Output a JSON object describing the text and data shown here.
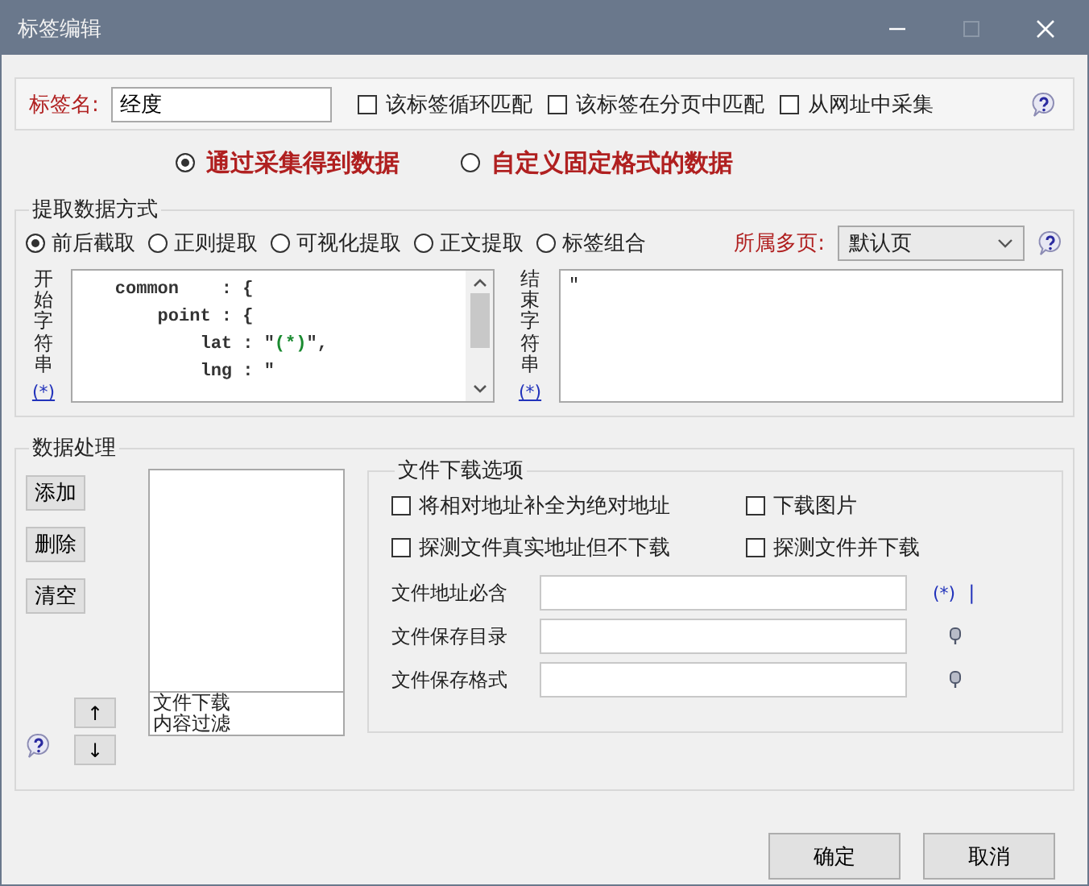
{
  "window": {
    "title": "标签编辑"
  },
  "tag_name": {
    "label": "标签名:",
    "value": "经度"
  },
  "tag_options": [
    {
      "label": "该标签循环匹配",
      "checked": false
    },
    {
      "label": "该标签在分页中匹配",
      "checked": false
    },
    {
      "label": "从网址中采集",
      "checked": false
    }
  ],
  "source_modes": [
    {
      "label": "通过采集得到数据",
      "selected": true
    },
    {
      "label": "自定义固定格式的数据",
      "selected": false
    }
  ],
  "extract": {
    "title": "提取数据方式",
    "methods": [
      {
        "label": "前后截取",
        "selected": true
      },
      {
        "label": "正则提取",
        "selected": false
      },
      {
        "label": "可视化提取",
        "selected": false
      },
      {
        "label": "正文提取",
        "selected": false
      },
      {
        "label": "标签组合",
        "selected": false
      }
    ],
    "page_label": "所属多页:",
    "page_value": "默认页",
    "start": {
      "label": "开始字符串",
      "wildcard": "(*)",
      "lines": [
        "    common    : {",
        "        point : {",
        "            lat : \"**(*)**\",",
        "            lng : \""
      ]
    },
    "end": {
      "label": "结束字符串",
      "wildcard": "(*)",
      "value": "\""
    }
  },
  "processing": {
    "title": "数据处理",
    "buttons": [
      "添加",
      "删除",
      "清空"
    ],
    "move_buttons": [
      "↑",
      "↓"
    ],
    "items": [
      "文件下载",
      "内容过滤"
    ],
    "download": {
      "title": "文件下载选项",
      "options": [
        {
          "label": "将相对地址补全为绝对地址",
          "checked": false
        },
        {
          "label": "下载图片",
          "checked": false
        },
        {
          "label": "探测文件真实地址但不下载",
          "checked": false
        },
        {
          "label": "探测文件并下载",
          "checked": false
        }
      ],
      "fields": [
        {
          "label": "文件地址必含",
          "kind": "wildcard",
          "link": "(*)",
          "mark": "|"
        },
        {
          "label": "文件保存目录",
          "kind": "pin"
        },
        {
          "label": "文件保存格式",
          "kind": "pin"
        }
      ]
    }
  },
  "buttons": [
    "确定",
    "取消"
  ]
}
